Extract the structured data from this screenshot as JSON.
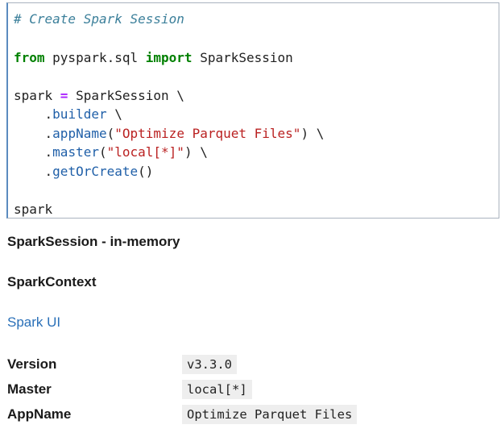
{
  "code_cell": {
    "lines": [
      {
        "tokens": [
          {
            "t": "comment",
            "v": "# Create Spark Session"
          }
        ]
      },
      {
        "tokens": []
      },
      {
        "tokens": [
          {
            "t": "kw",
            "v": "from"
          },
          {
            "t": "plain",
            "v": " pyspark.sql "
          },
          {
            "t": "kw",
            "v": "import"
          },
          {
            "t": "plain",
            "v": " SparkSession"
          }
        ]
      },
      {
        "tokens": []
      },
      {
        "tokens": [
          {
            "t": "plain",
            "v": "spark "
          },
          {
            "t": "op",
            "v": "="
          },
          {
            "t": "plain",
            "v": " SparkSession \\"
          }
        ]
      },
      {
        "tokens": [
          {
            "t": "plain",
            "v": "    ."
          },
          {
            "t": "attr",
            "v": "builder"
          },
          {
            "t": "plain",
            "v": " \\"
          }
        ]
      },
      {
        "tokens": [
          {
            "t": "plain",
            "v": "    ."
          },
          {
            "t": "attr",
            "v": "appName"
          },
          {
            "t": "plain",
            "v": "("
          },
          {
            "t": "str",
            "v": "\"Optimize Parquet Files\""
          },
          {
            "t": "plain",
            "v": ") \\"
          }
        ]
      },
      {
        "tokens": [
          {
            "t": "plain",
            "v": "    ."
          },
          {
            "t": "attr",
            "v": "master"
          },
          {
            "t": "plain",
            "v": "("
          },
          {
            "t": "str",
            "v": "\"local[*]\""
          },
          {
            "t": "plain",
            "v": ") \\"
          }
        ]
      },
      {
        "tokens": [
          {
            "t": "plain",
            "v": "    ."
          },
          {
            "t": "attr",
            "v": "getOrCreate"
          },
          {
            "t": "plain",
            "v": "()"
          }
        ]
      },
      {
        "tokens": []
      },
      {
        "tokens": [
          {
            "t": "plain",
            "v": "spark"
          }
        ]
      }
    ]
  },
  "output": {
    "session_heading": "SparkSession - in-memory",
    "context_heading": "SparkContext",
    "ui_link": "Spark UI",
    "info": [
      {
        "key": "Version",
        "value": "v3.3.0"
      },
      {
        "key": "Master",
        "value": "local[*]"
      },
      {
        "key": "AppName",
        "value": "Optimize Parquet Files"
      }
    ]
  }
}
